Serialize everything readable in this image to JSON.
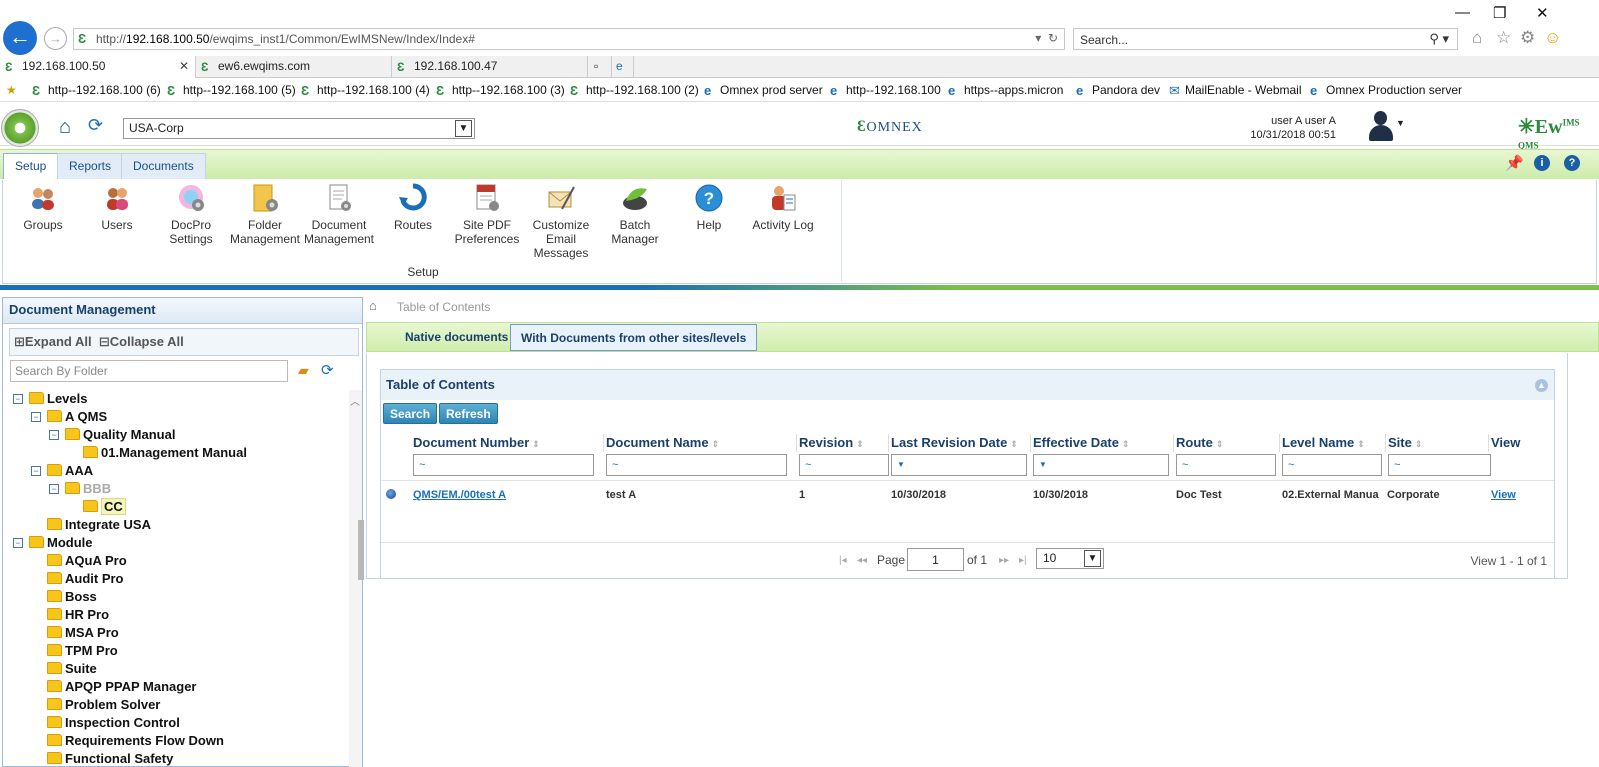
{
  "browser": {
    "url_prefix": "http://",
    "url_host": "192.168.100.50",
    "url_path": "/ewqims_inst1/Common/EwIMSNew/Index/Index#",
    "search_placeholder": "Search...",
    "tabs": [
      {
        "label": "192.168.100.50"
      },
      {
        "label": "ew6.ewqims.com"
      },
      {
        "label": "192.168.100.47"
      }
    ],
    "favorites": [
      {
        "label": "http--192.168.100 (6)"
      },
      {
        "label": "http--192.168.100 (5)"
      },
      {
        "label": "http--192.168.100 (4)"
      },
      {
        "label": "http--192.168.100 (3)"
      },
      {
        "label": "http--192.168.100 (2)"
      },
      {
        "label": "Omnex prod server"
      },
      {
        "label": "http--192.168.100"
      },
      {
        "label": "https--apps.micron"
      },
      {
        "label": "Pandora dev"
      },
      {
        "label": "MailEnable - Webmail"
      },
      {
        "label": "Omnex Production server"
      }
    ]
  },
  "header": {
    "site": "USA-Corp",
    "brand_omnex": "OMNEX",
    "user_name": "user A user A",
    "datetime": "10/31/2018 00:51",
    "brand_right": "Ew",
    "brand_right_super": "IMS",
    "brand_right_sub": "QMS"
  },
  "ribbon": {
    "tabs": [
      {
        "label": "Setup"
      },
      {
        "label": "Reports"
      },
      {
        "label": "Documents"
      }
    ],
    "buttons": [
      {
        "label": "Groups"
      },
      {
        "label": "Users"
      },
      {
        "label": "DocPro Settings"
      },
      {
        "label": "Folder Management"
      },
      {
        "label": "Document Management"
      },
      {
        "label": "Routes"
      },
      {
        "label": "Site PDF Preferences"
      },
      {
        "label": "Customize Email Messages"
      },
      {
        "label": "Batch Manager"
      },
      {
        "label": "Help"
      },
      {
        "label": "Activity Log"
      }
    ],
    "group_label": "Setup"
  },
  "left_pane": {
    "title": "Document Management",
    "expand_all": "Expand All",
    "collapse_all": "Collapse All",
    "search_placeholder": "Search By Folder",
    "tree": [
      {
        "label": "Levels"
      },
      {
        "label": "A QMS"
      },
      {
        "label": "Quality Manual"
      },
      {
        "label": "01.Management Manual"
      },
      {
        "label": "AAA"
      },
      {
        "label": "BBB"
      },
      {
        "label": "CC"
      },
      {
        "label": "Integrate USA"
      },
      {
        "label": "Module"
      },
      {
        "label": "AQuA Pro"
      },
      {
        "label": "Audit Pro"
      },
      {
        "label": "Boss"
      },
      {
        "label": "HR Pro"
      },
      {
        "label": "MSA Pro"
      },
      {
        "label": "TPM Pro"
      },
      {
        "label": "Suite"
      },
      {
        "label": "APQP PPAP Manager"
      },
      {
        "label": "Problem Solver"
      },
      {
        "label": "Inspection Control"
      },
      {
        "label": "Requirements Flow Down"
      },
      {
        "label": "Functional Safety"
      }
    ]
  },
  "main": {
    "breadcrumb": "Table of Contents",
    "tabs": [
      {
        "label": "Native documents"
      },
      {
        "label": "With Documents from other sites/levels"
      }
    ],
    "panel_title": "Table of Contents",
    "search_button": "Search",
    "refresh_button": "Refresh",
    "columns": [
      {
        "label": "Document Number"
      },
      {
        "label": "Document Name"
      },
      {
        "label": "Revision"
      },
      {
        "label": "Last Revision Date"
      },
      {
        "label": "Effective Date"
      },
      {
        "label": "Route"
      },
      {
        "label": "Level Name"
      },
      {
        "label": "Site"
      },
      {
        "label": "View"
      }
    ],
    "filter_symbols": {
      "tilde": "~",
      "funnel": "▼"
    },
    "rows": [
      {
        "doc_number": "QMS/EM./00test A",
        "doc_name": "test A",
        "revision": "1",
        "last_revision_date": "10/30/2018",
        "effective_date": "10/30/2018",
        "route": "Doc Test",
        "level_name": "02.External Manua",
        "site": "Corporate",
        "view": "View"
      }
    ],
    "pager": {
      "page_label": "Page",
      "page_value": "1",
      "of_label": "of 1",
      "page_size": "10",
      "info": "View 1 - 1 of 1"
    }
  },
  "colors": {
    "accent_blue": "#1a6fb8",
    "accent_green": "#7cc04a",
    "folder": "#f7c51c"
  }
}
